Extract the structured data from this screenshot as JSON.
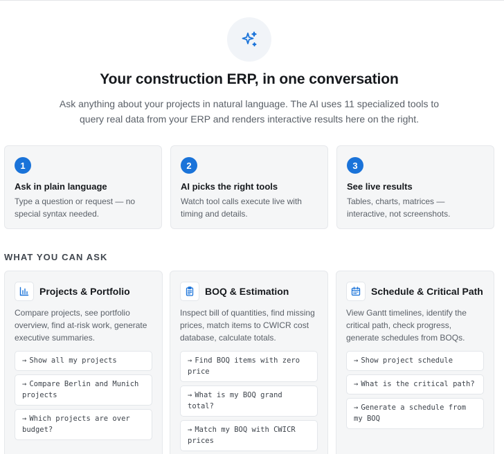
{
  "hero": {
    "icon": "sparkles-icon",
    "title": "Your construction ERP, in one conversation",
    "subtitle": "Ask anything about your projects in natural language. The AI uses 11 specialized tools to query real data from your ERP and renders interactive results here on the right."
  },
  "steps": [
    {
      "number": "1",
      "title": "Ask in plain language",
      "description": "Type a question or request — no special syntax needed."
    },
    {
      "number": "2",
      "title": "AI picks the right tools",
      "description": "Watch tool calls execute live with timing and details."
    },
    {
      "number": "3",
      "title": "See live results",
      "description": "Tables, charts, matrices — interactive, not screenshots."
    }
  ],
  "section_label": "WHAT YOU CAN ASK",
  "categories": [
    {
      "icon": "bar-chart-icon",
      "title": "Projects & Portfolio",
      "description": "Compare projects, see portfolio overview, find at-risk work, generate executive summaries.",
      "prompts": [
        "Show all my projects",
        "Compare Berlin and Munich projects",
        "Which projects are over budget?"
      ]
    },
    {
      "icon": "clipboard-icon",
      "title": "BOQ & Estimation",
      "description": "Inspect bill of quantities, find missing prices, match items to CWICR cost database, calculate totals.",
      "prompts": [
        "Find BOQ items with zero price",
        "What is my BOQ grand total?",
        "Match my BOQ with CWICR prices"
      ]
    },
    {
      "icon": "calendar-icon",
      "title": "Schedule & Critical Path",
      "description": "View Gantt timelines, identify the critical path, check progress, generate schedules from BOQs.",
      "prompts": [
        "Show project schedule",
        "What is the critical path?",
        "Generate a schedule from my BOQ"
      ]
    }
  ],
  "prompt_arrow": "→",
  "colors": {
    "accent": "#1a73d9",
    "card_bg": "#f5f6f7",
    "border": "#e6e8eb"
  }
}
